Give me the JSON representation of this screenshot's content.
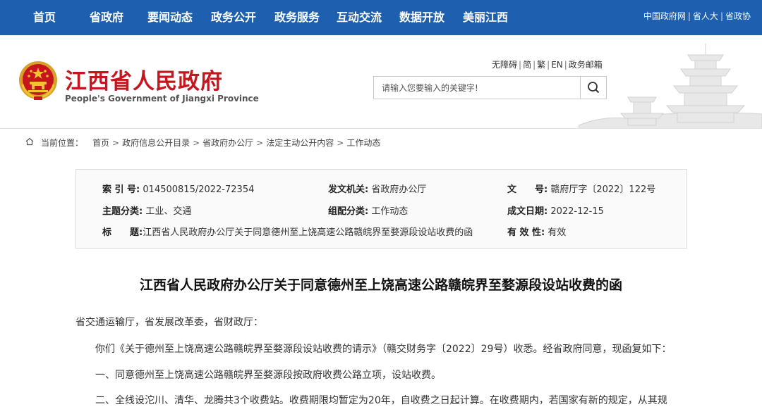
{
  "nav": {
    "items": [
      "首页",
      "省政府",
      "要闻动态",
      "政务公开",
      "政务服务",
      "互动交流",
      "数据开放",
      "美丽江西"
    ],
    "links": [
      "中国政府网",
      "省人大",
      "省政协"
    ]
  },
  "header": {
    "title_cn": "江西省人民政府",
    "title_en": "People's Government of Jiangxi Province",
    "tools": [
      "无障碍",
      "简",
      "繁",
      "EN",
      "政务邮箱"
    ],
    "search_placeholder": "请输入您要输入的关键字!",
    "emblem_icon": "national-emblem-icon",
    "search_icon": "search-icon"
  },
  "breadcrumb": {
    "label": "当前位置：",
    "path": [
      "首页",
      "政府信息公开目录",
      "省政府办公厅",
      "法定主动公开内容",
      "工作动态"
    ],
    "icon": "home-icon"
  },
  "info": {
    "index_label": "索 引 号:",
    "index_value": "014500815/2022-72354",
    "issuer_label": "发文机关:",
    "issuer_value": "省政府办公厅",
    "docno_label": "文　　号:",
    "docno_value": "赣府厅字〔2022〕122号",
    "topic_label": "主题分类:",
    "topic_value": "工业、交通",
    "category_label": "组配分类:",
    "category_value": "工作动态",
    "date_label": "成文日期:",
    "date_value": "2022-12-15",
    "title_label": "标　　题:",
    "title_value": "江西省人民政府办公厅关于同意德州至上饶高速公路赣皖界至婺源段设站收费的函",
    "valid_label": "有 效 性:",
    "valid_value": "有效"
  },
  "article": {
    "title": "江西省人民政府办公厅关于同意德州至上饶高速公路赣皖界至婺源段设站收费的函",
    "salutation": "省交通运输厅，省发展改革委，省财政厅：",
    "p1": "你们《关于德州至上饶高速公路赣皖界至婺源段设站收费的请示》（赣交财务字〔2022〕29号）收悉。经省政府同意，现函复如下：",
    "p2": "一、同意德州至上饶高速公路赣皖界至婺源段按政府收费公路立项，设站收费。",
    "p3": "二、全线设沱川、清华、龙腾共3个收费站。收费期限均暂定为20年，自收费之日起计算。在收费期内，若国家有新的规定，从其规"
  },
  "colors": {
    "nav_bg": "#1f5fb0",
    "title_red": "#c8141c"
  }
}
